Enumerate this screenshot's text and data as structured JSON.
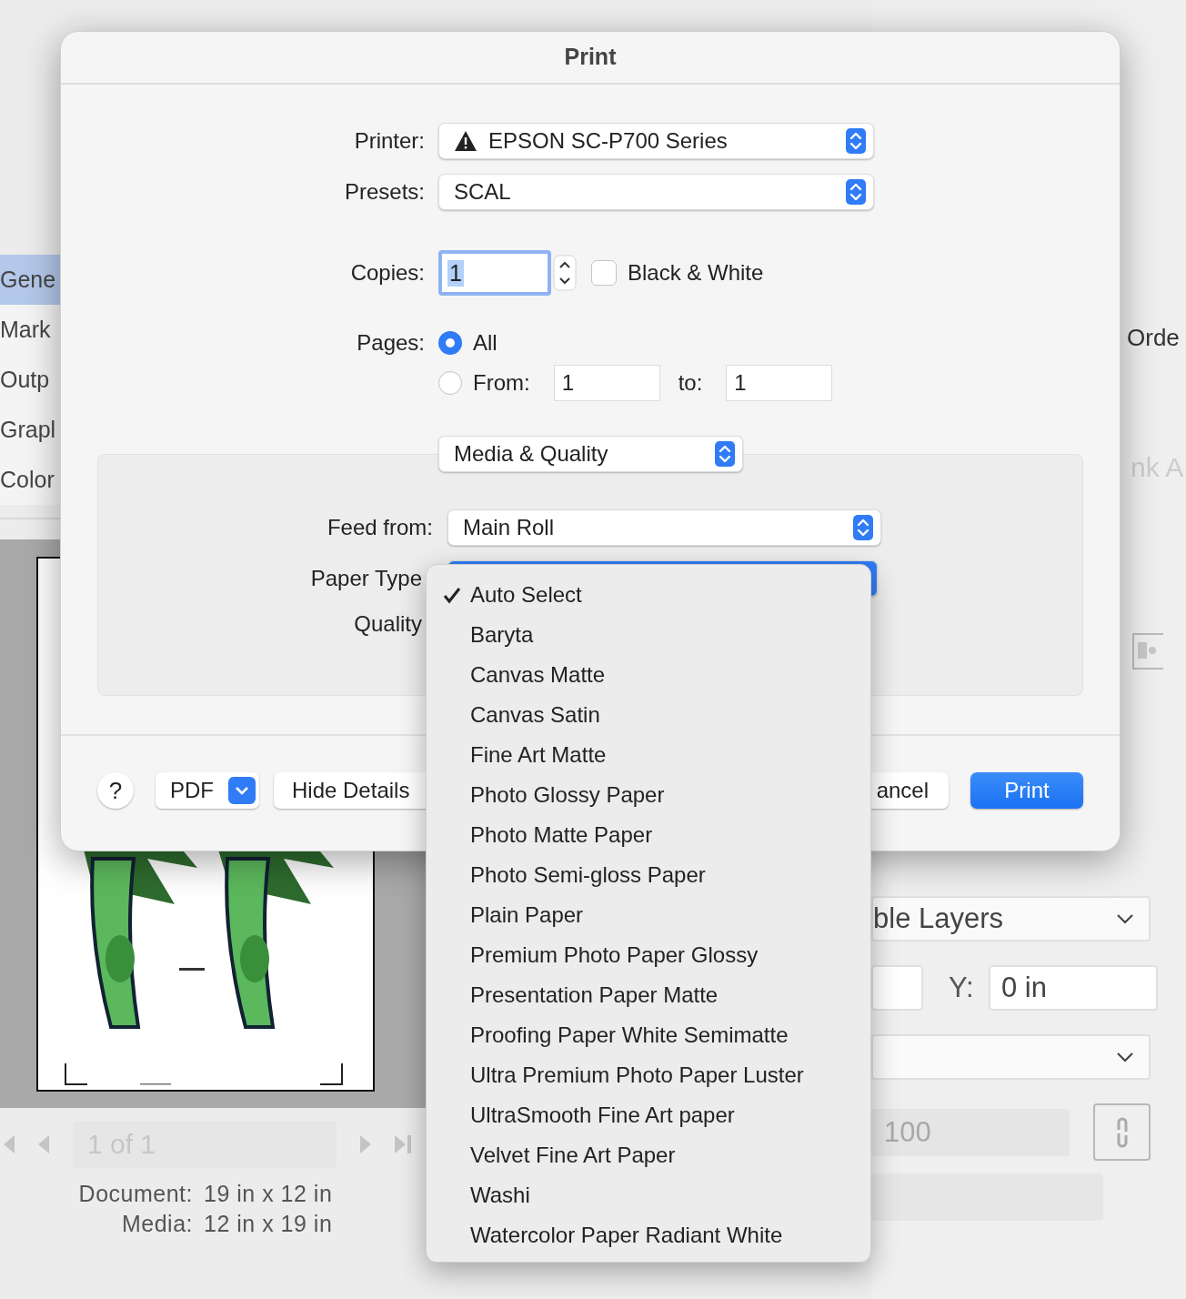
{
  "background": {
    "sidebar_items": [
      {
        "label": "Gene",
        "selected": true
      },
      {
        "label": "Mark",
        "selected": false
      },
      {
        "label": "Outp",
        "selected": false
      },
      {
        "label": "Grapl",
        "selected": false
      },
      {
        "label": "Color",
        "selected": false
      }
    ],
    "preview": {
      "kind": "picture",
      "page_field": "1 of 1",
      "document_label": "Document:",
      "document_value": "19 in x 12 in",
      "media_label": "Media:",
      "media_value": "12 in x 19 in"
    },
    "right_panel": {
      "heading": "Orde",
      "dim_label": "nk A",
      "layers_select": "ble Layers",
      "y_label": "Y:",
      "y_value": "0 in",
      "scale_value": "100"
    }
  },
  "dialog": {
    "title": "Print",
    "printer_label": "Printer:",
    "printer": "EPSON SC-P700 Series",
    "printer_warning": true,
    "presets_label": "Presets:",
    "presets": "SCAL",
    "copies_label": "Copies:",
    "copies": "1",
    "black_white": {
      "label": "Black & White",
      "checked": false
    },
    "pages_label": "Pages:",
    "page_options": [
      {
        "label": "All",
        "selected": true
      },
      {
        "label": "From:",
        "selected": false
      }
    ],
    "from": "1",
    "to_label": "to:",
    "to": "1",
    "panel": "Media & Quality",
    "feed_label": "Feed from:",
    "feed": "Main Roll",
    "paper_type_label": "Paper Type",
    "quality_label": "Quality",
    "help": "?",
    "pdf": "PDF",
    "hide_details": "Hide Details",
    "cancel": "ancel",
    "print": "Print"
  },
  "paper_menu": {
    "items": [
      {
        "label": "Auto Select",
        "selected": true
      },
      {
        "label": "Baryta",
        "selected": false
      },
      {
        "label": "Canvas Matte",
        "selected": false
      },
      {
        "label": "Canvas Satin",
        "selected": false
      },
      {
        "label": "Fine Art Matte",
        "selected": false
      },
      {
        "label": "Photo Glossy Paper",
        "selected": false
      },
      {
        "label": "Photo Matte Paper",
        "selected": false
      },
      {
        "label": "Photo Semi-gloss Paper",
        "selected": false
      },
      {
        "label": "Plain Paper",
        "selected": false
      },
      {
        "label": "Premium Photo Paper Glossy",
        "selected": false
      },
      {
        "label": "Presentation Paper Matte",
        "selected": false
      },
      {
        "label": "Proofing Paper White Semimatte",
        "selected": false
      },
      {
        "label": "Ultra Premium Photo Paper Luster",
        "selected": false
      },
      {
        "label": "UltraSmooth Fine Art paper",
        "selected": false
      },
      {
        "label": "Velvet Fine Art Paper",
        "selected": false
      },
      {
        "label": "Washi",
        "selected": false
      },
      {
        "label": "Watercolor Paper Radiant White",
        "selected": false
      }
    ]
  }
}
